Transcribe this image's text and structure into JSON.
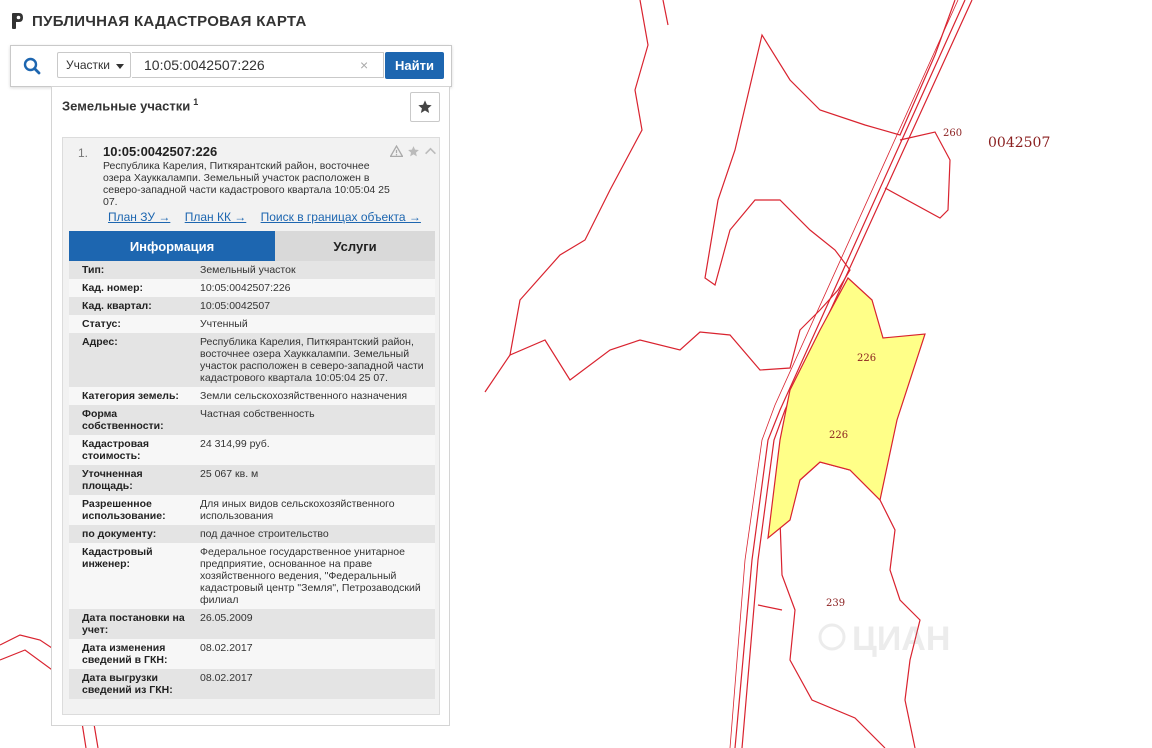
{
  "app": {
    "title": "ПУБЛИЧНАЯ КАДАСТРОВАЯ КАРТА"
  },
  "search": {
    "type_label": "Участки",
    "query": "10:05:0042507:226",
    "clear_symbol": "×",
    "button_label": "Найти"
  },
  "panel": {
    "title": "Земельные участки",
    "count": "1"
  },
  "result": {
    "index": "1.",
    "number": "10:05:0042507:226",
    "description": "Республика Карелия, Питкярантский район, восточнее озера Хауккалампи. Земельный участок расположен в северо-западной части кадастрового квартала 10:05:04 25 07.",
    "links": [
      "План ЗУ →",
      "План КК →",
      "Поиск в границах объекта →"
    ]
  },
  "tabs": {
    "info": "Информация",
    "services": "Услуги"
  },
  "info_rows": [
    {
      "label": "Тип:",
      "value": "Земельный участок"
    },
    {
      "label": "Кад. номер:",
      "value": "10:05:0042507:226"
    },
    {
      "label": "Кад. квартал:",
      "value": "10:05:0042507"
    },
    {
      "label": "Статус:",
      "value": "Учтенный"
    },
    {
      "label": "Адрес:",
      "value": "Республика Карелия, Питкярантский район, восточнее озера Хауккалампи. Земельный участок расположен в северо-западной части кадастрового квартала 10:05:04 25 07."
    },
    {
      "label": "Категория земель:",
      "value": "Земли сельскохозяйственного назначения"
    },
    {
      "label": "Форма собственности:",
      "value": "Частная собственность"
    },
    {
      "label": "Кадастровая стоимость:",
      "value": "24 314,99 руб."
    },
    {
      "label": "Уточненная площадь:",
      "value": "25 067 кв. м"
    },
    {
      "label": "Разрешенное использование:",
      "value": "Для иных видов сельскохозяйственного использования"
    },
    {
      "label": "по документу:",
      "value": "под дачное строительство"
    },
    {
      "label": "Кадастровый инженер:",
      "value": "Федеральное государственное унитарное предприятие, основанное на праве хозяйственного ведения, \"Федеральный кадастровый центр \"Земля\", Петрозаводский филиал"
    },
    {
      "label": "Дата постановки на учет:",
      "value": "26.05.2009"
    },
    {
      "label": "Дата изменения сведений в ГКН:",
      "value": "08.02.2017"
    },
    {
      "label": "Дата выгрузки сведений из ГКН:",
      "value": "08.02.2017"
    }
  ],
  "map": {
    "quarter_label": "0042507",
    "parcel_labels": [
      "260",
      "226",
      "226",
      "239"
    ],
    "watermark": "ЦИАН"
  },
  "colors": {
    "accent": "#1d66b0",
    "parcel_border": "#d9232f",
    "selected_fill": "#ffff88",
    "label": "#8a1f1f"
  }
}
